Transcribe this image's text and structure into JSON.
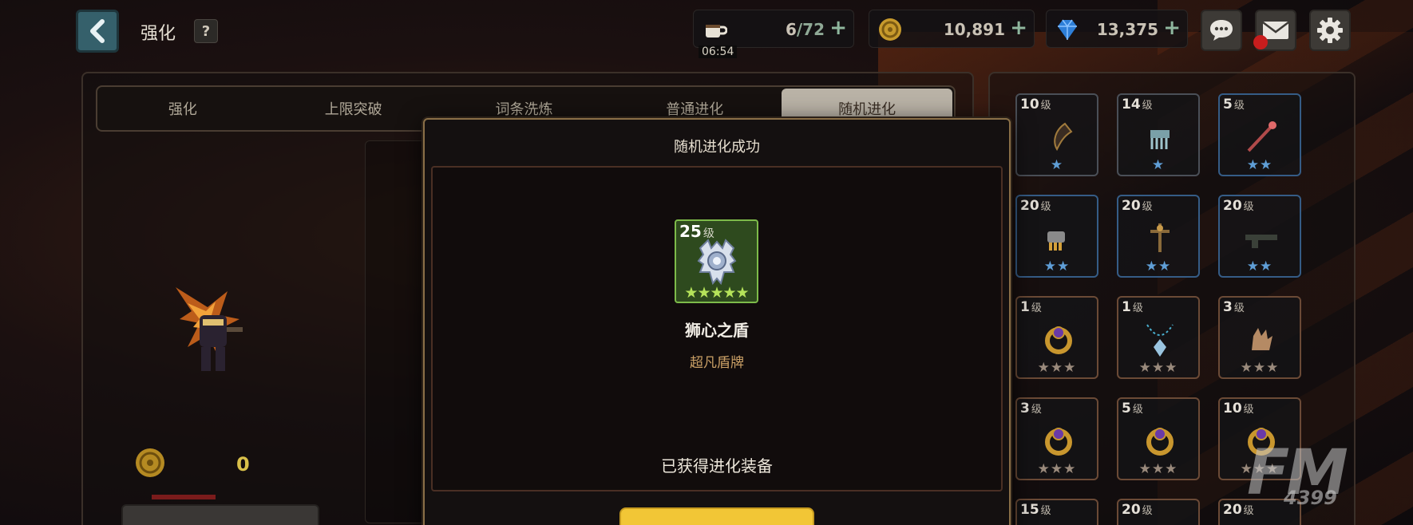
{
  "header": {
    "title": "强化",
    "help_label": "?"
  },
  "resources": {
    "stamina": {
      "current": "6",
      "max": "/72",
      "plus": "+",
      "timer": "06:54"
    },
    "gold": {
      "value": "10,891",
      "plus": "+"
    },
    "gems": {
      "value": "13,375",
      "plus": "+"
    }
  },
  "tabs": [
    {
      "label": "强化",
      "active": false
    },
    {
      "label": "上限突破",
      "active": false
    },
    {
      "label": "词条洗炼",
      "active": false
    },
    {
      "label": "普通进化",
      "active": false
    },
    {
      "label": "随机进化",
      "active": true
    }
  ],
  "left": {
    "coin_count": "0"
  },
  "inventory": [
    {
      "level": "10",
      "unit": "级",
      "stars": "★",
      "frame": "grey",
      "icon": "scythe-icon"
    },
    {
      "level": "14",
      "unit": "级",
      "stars": "★",
      "frame": "grey",
      "icon": "claw-icon"
    },
    {
      "level": "5",
      "unit": "级",
      "stars": "★★",
      "frame": "blue",
      "icon": "staff-icon"
    },
    {
      "level": "20",
      "unit": "级",
      "stars": "★★",
      "frame": "blue",
      "icon": "gauntlet-icon"
    },
    {
      "level": "20",
      "unit": "级",
      "stars": "★★",
      "frame": "blue",
      "icon": "crossbow-icon"
    },
    {
      "level": "20",
      "unit": "级",
      "stars": "★★",
      "frame": "blue",
      "icon": "rifle-icon"
    },
    {
      "level": "1",
      "unit": "级",
      "stars": "★★★",
      "frame": "brown",
      "icon": "ring-icon"
    },
    {
      "level": "1",
      "unit": "级",
      "stars": "★★★",
      "frame": "brown",
      "icon": "necklace-icon"
    },
    {
      "level": "3",
      "unit": "级",
      "stars": "★★★",
      "frame": "brown",
      "icon": "glove-icon"
    },
    {
      "level": "3",
      "unit": "级",
      "stars": "★★★",
      "frame": "brown",
      "icon": "ring-icon"
    },
    {
      "level": "5",
      "unit": "级",
      "stars": "★★★",
      "frame": "brown",
      "icon": "ring-icon"
    },
    {
      "level": "10",
      "unit": "级",
      "stars": "★★★",
      "frame": "brown",
      "icon": "ring-icon"
    },
    {
      "level": "15",
      "unit": "级",
      "stars": "",
      "frame": "brown",
      "icon": "necklace-icon"
    },
    {
      "level": "20",
      "unit": "级",
      "stars": "",
      "frame": "brown",
      "icon": "ring-icon"
    },
    {
      "level": "20",
      "unit": "级",
      "stars": "",
      "frame": "brown",
      "icon": "ring-icon"
    }
  ],
  "modal": {
    "title": "随机进化成功",
    "item": {
      "level": "25",
      "unit": "级",
      "stars": "★★★★★",
      "name": "狮心之盾",
      "type": "超凡盾牌",
      "icon": "shield-icon"
    },
    "obtained_text": "已获得进化装备"
  },
  "watermark": {
    "main": "FM",
    "sub": "4399"
  }
}
